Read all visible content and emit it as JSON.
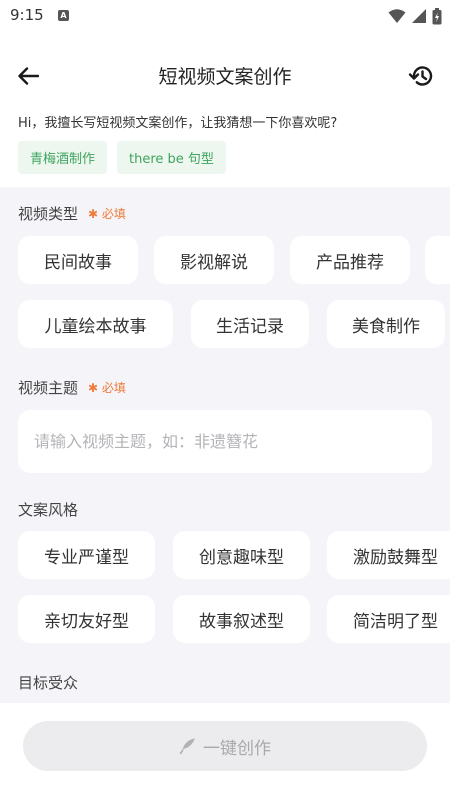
{
  "status_bar": {
    "time": "9:15",
    "app_badge": "A"
  },
  "header": {
    "title": "短视频文案创作",
    "back_icon": "arrow-left-icon",
    "history_icon": "history-icon"
  },
  "intro_text": "Hi，我擅长写短视频文案创作，让我猜想一下你喜欢呢?",
  "suggestions": [
    "青梅酒制作",
    "there be 句型"
  ],
  "video_type": {
    "label": "视频类型",
    "required": "✱ 必填",
    "options": [
      "民间故事",
      "影视解说",
      "产品推荐",
      "",
      "儿童绘本故事",
      "生活记录",
      "美食制作"
    ]
  },
  "video_topic": {
    "label": "视频主题",
    "required": "✱ 必填",
    "placeholder": "请输入视频主题，如：非遗簪花",
    "value": ""
  },
  "copy_style": {
    "label": "文案风格",
    "options": [
      "专业严谨型",
      "创意趣味型",
      "激励鼓舞型",
      "亲切友好型",
      "故事叙述型",
      "简洁明了型"
    ]
  },
  "audience": {
    "label": "目标受众"
  },
  "create_button": {
    "label": "一键创作",
    "icon": "feather-icon"
  },
  "colors": {
    "accent_green": "#3fa45f",
    "required_orange": "#f07a3a",
    "panel_bg": "#f5f5f9"
  }
}
